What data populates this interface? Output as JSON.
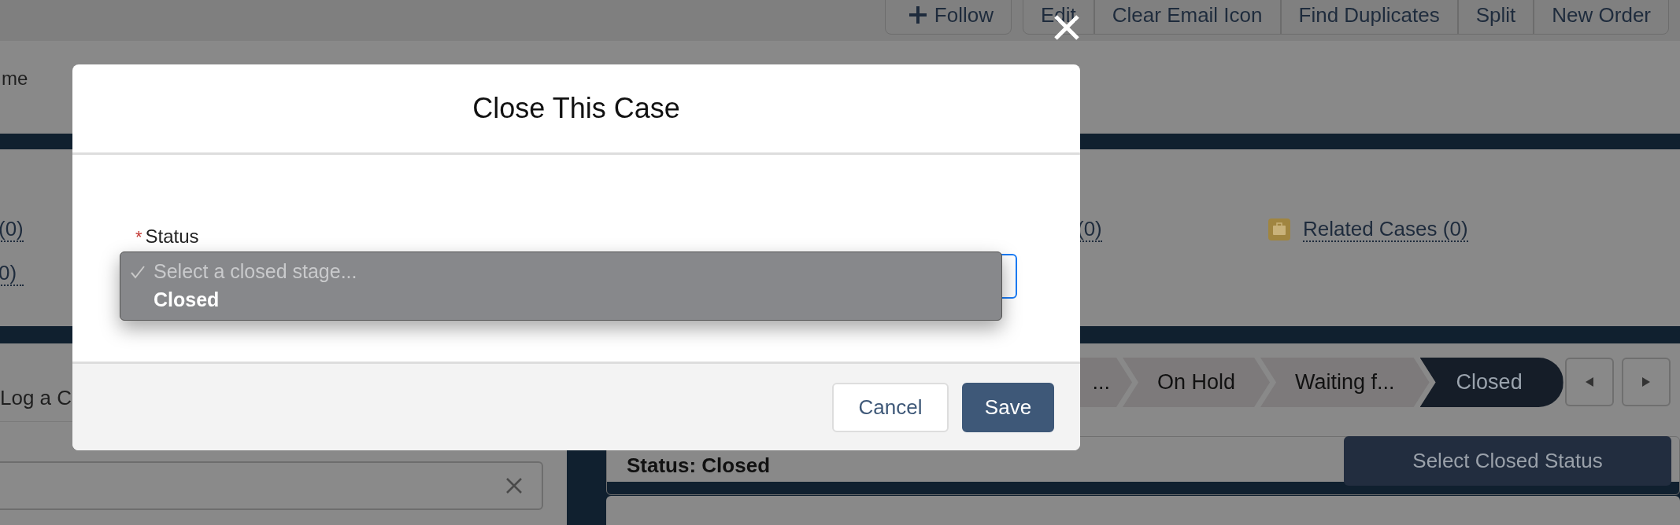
{
  "header_buttons": [
    {
      "label": "Follow",
      "kind": "icon"
    },
    {
      "label": "Edit",
      "kind": "text"
    },
    {
      "label": "Clear Email Icon",
      "kind": "text"
    },
    {
      "label": "Find Duplicates",
      "kind": "text"
    },
    {
      "label": "Split",
      "kind": "text"
    },
    {
      "label": "New Order",
      "kind": "text"
    }
  ],
  "record_name_fragment": "me",
  "related_lists": {
    "left": [
      "(0)",
      "0)"
    ],
    "middle": [
      "(0)"
    ],
    "right": [
      "Related Cases (0)"
    ]
  },
  "tab_fragment": "Log a C",
  "path": {
    "stages": [
      {
        "label": "...",
        "selected": false
      },
      {
        "label": "On Hold",
        "selected": false
      },
      {
        "label": "Waiting f...",
        "selected": false
      },
      {
        "label": "Closed",
        "selected": true
      }
    ]
  },
  "status_card": {
    "text": "Status: Closed",
    "button": "Select Closed Status"
  },
  "modal": {
    "title": "Close This Case",
    "field": {
      "label": "Status",
      "required_mark": "*"
    },
    "options": [
      {
        "label": "Select a closed stage...",
        "checked": true,
        "disabled": true
      },
      {
        "label": "Closed",
        "checked": false,
        "disabled": false
      }
    ],
    "buttons": [
      {
        "label": "Cancel",
        "kind": "neutral"
      },
      {
        "label": "Save",
        "kind": "brand"
      }
    ]
  }
}
